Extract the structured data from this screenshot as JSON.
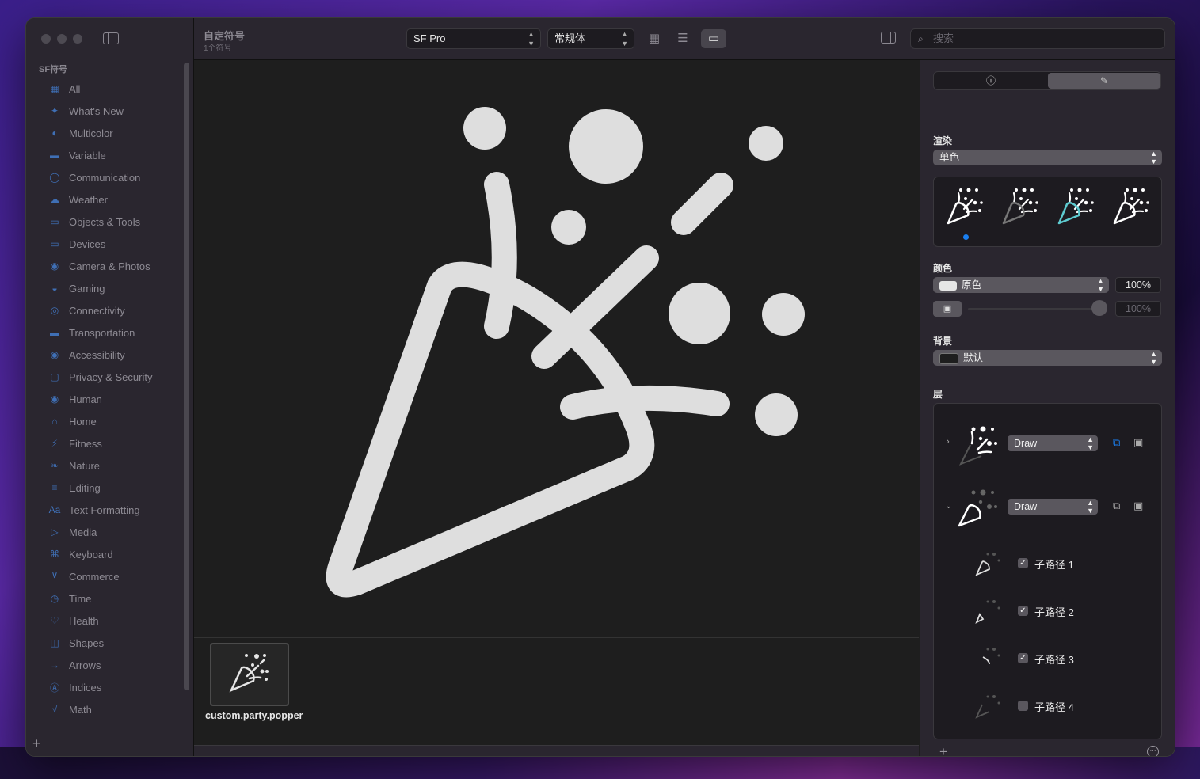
{
  "sidebar": {
    "section": "SF符号",
    "items": [
      {
        "label": "All",
        "icon": "grid-icon",
        "glyph": "▦"
      },
      {
        "label": "What's New",
        "icon": "sparkle-icon",
        "glyph": "✦"
      },
      {
        "label": "Multicolor",
        "icon": "palette-icon",
        "glyph": "◐"
      },
      {
        "label": "Variable",
        "icon": "slider-icon",
        "glyph": "▬"
      },
      {
        "label": "Communication",
        "icon": "bubble-icon",
        "glyph": "◯"
      },
      {
        "label": "Weather",
        "icon": "cloud-sun-icon",
        "glyph": "☁"
      },
      {
        "label": "Objects & Tools",
        "icon": "folder-icon",
        "glyph": "▭"
      },
      {
        "label": "Devices",
        "icon": "display-icon",
        "glyph": "▭"
      },
      {
        "label": "Camera & Photos",
        "icon": "camera-icon",
        "glyph": "◉"
      },
      {
        "label": "Gaming",
        "icon": "gamecontroller-icon",
        "glyph": "◒"
      },
      {
        "label": "Connectivity",
        "icon": "antenna-icon",
        "glyph": "◎"
      },
      {
        "label": "Transportation",
        "icon": "car-icon",
        "glyph": "▬"
      },
      {
        "label": "Accessibility",
        "icon": "accessibility-icon",
        "glyph": "◉"
      },
      {
        "label": "Privacy & Security",
        "icon": "lock-icon",
        "glyph": "▢"
      },
      {
        "label": "Human",
        "icon": "person-icon",
        "glyph": "◉"
      },
      {
        "label": "Home",
        "icon": "house-icon",
        "glyph": "⌂"
      },
      {
        "label": "Fitness",
        "icon": "figure-run-icon",
        "glyph": "⚡"
      },
      {
        "label": "Nature",
        "icon": "leaf-icon",
        "glyph": "❧"
      },
      {
        "label": "Editing",
        "icon": "sliders-icon",
        "glyph": "≡"
      },
      {
        "label": "Text Formatting",
        "icon": "textformat-icon",
        "glyph": "Aa"
      },
      {
        "label": "Media",
        "icon": "playpause-icon",
        "glyph": "▷"
      },
      {
        "label": "Keyboard",
        "icon": "command-icon",
        "glyph": "⌘"
      },
      {
        "label": "Commerce",
        "icon": "cart-icon",
        "glyph": "⊻"
      },
      {
        "label": "Time",
        "icon": "clock-icon",
        "glyph": "◷"
      },
      {
        "label": "Health",
        "icon": "heart-icon",
        "glyph": "♡"
      },
      {
        "label": "Shapes",
        "icon": "shapes-icon",
        "glyph": "◫"
      },
      {
        "label": "Arrows",
        "icon": "arrow-right-icon",
        "glyph": "→"
      },
      {
        "label": "Indices",
        "icon": "a-circle-icon",
        "glyph": "Ⓐ"
      },
      {
        "label": "Math",
        "icon": "sqrt-icon",
        "glyph": "√"
      }
    ],
    "add_label": "+"
  },
  "toolbar": {
    "title": "自定符号",
    "subtitle": "1个符号",
    "font_popup": "SF Pro",
    "weight_popup": "常规体",
    "search_placeholder": "搜索"
  },
  "gallery": {
    "selected_name": "custom.party.popper"
  },
  "inspector": {
    "rendering_label": "渲染",
    "rendering_mode": "单色",
    "color_label": "颜色",
    "color_value": "原色",
    "color_swatch": "#e6e6e6",
    "opacity_primary": "100%",
    "opacity_secondary": "100%",
    "background_label": "背景",
    "background_value": "默认",
    "background_swatch": "#1e1e1e",
    "layers_label": "层",
    "layers": [
      {
        "mode": "Draw"
      },
      {
        "mode": "Draw"
      }
    ],
    "sublayers": [
      {
        "label": "子路径 1",
        "checked": true
      },
      {
        "label": "子路径 2",
        "checked": true
      },
      {
        "label": "子路径 3",
        "checked": true
      },
      {
        "label": "子路径 4",
        "checked": false
      }
    ],
    "accent_color": "#5ecbd0"
  }
}
